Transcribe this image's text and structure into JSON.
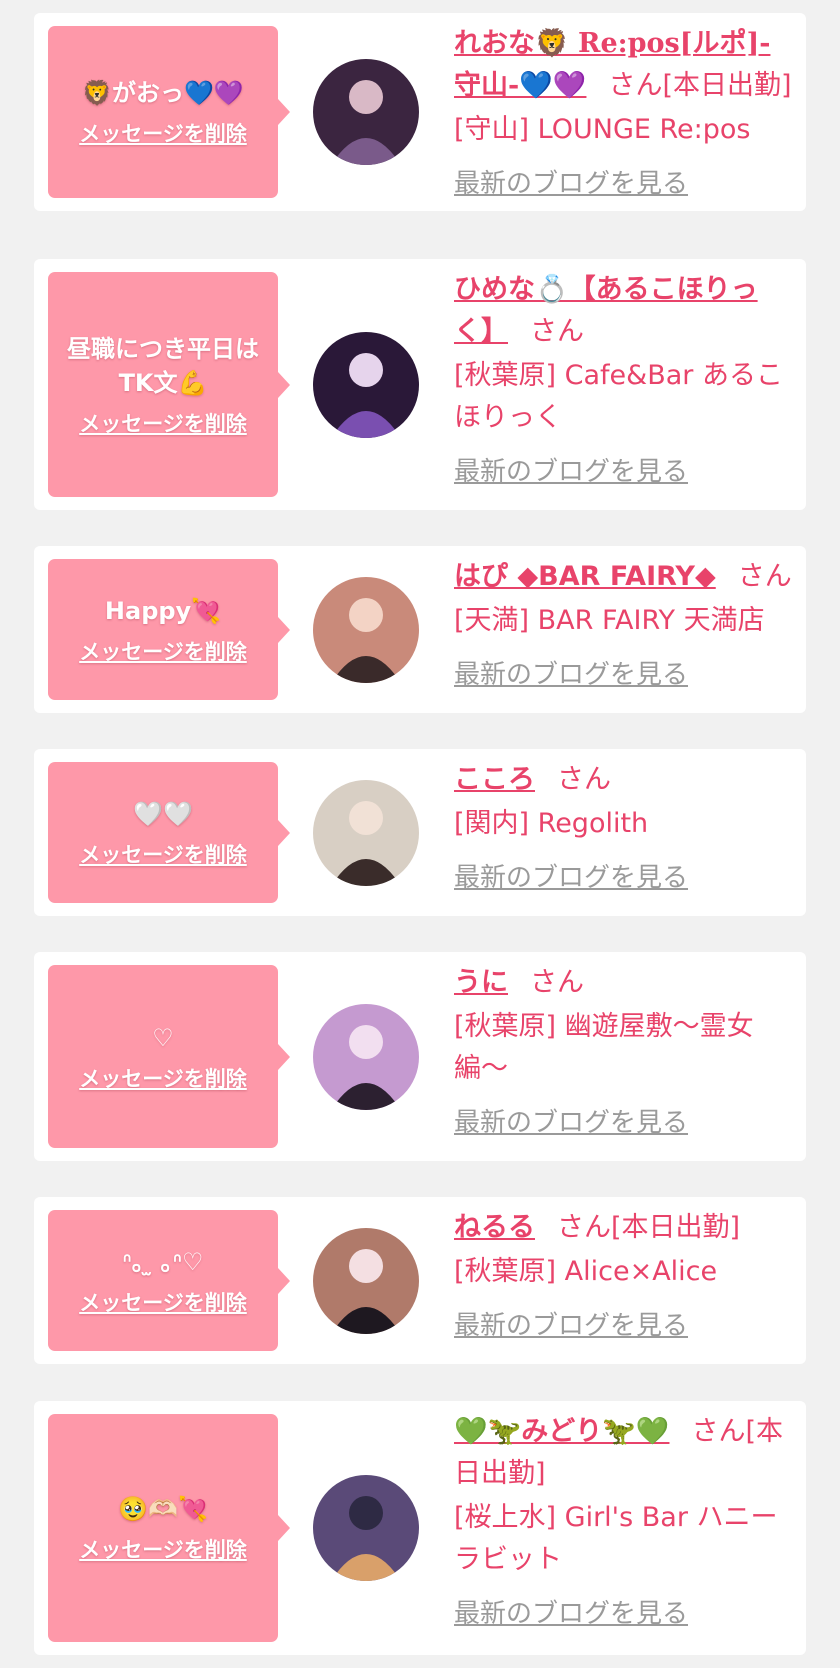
{
  "delete_label": "メッセージを削除",
  "blog_label": "最新のブログを見る",
  "colors": {
    "bubble": "#fe98a9",
    "accent": "#e8436a",
    "link_gray": "#9a9a9a",
    "background": "#f1f1f1"
  },
  "entries": [
    {
      "message": "🦁がおっ💙💜",
      "name": "れおな🦁 Re:pos[ルポ]-守山-💙💜",
      "suffix": "さん[本日出勤]",
      "shop": "[守山] LOUNGE Re:pos",
      "avatar_colors": [
        "#3b2540",
        "#7a5a8a",
        "#d9b9c6"
      ]
    },
    {
      "message": "昼職につき平日は\nTK文💪",
      "name": "ひめな💍【あるこほりっく】",
      "suffix": "さん",
      "shop": "[秋葉原] Cafe&Bar あるこほりっく",
      "avatar_colors": [
        "#2a1838",
        "#7a4fb0",
        "#e6d4ec"
      ]
    },
    {
      "message": "Happy💘",
      "name": "はぴ ◆BAR FAIRY◆",
      "suffix": "さん",
      "shop": "[天満] BAR FAIRY 天満店",
      "avatar_colors": [
        "#c98a7a",
        "#3a2a2a",
        "#f3d3c5"
      ]
    },
    {
      "message": "🤍🤍",
      "name": "こころ",
      "suffix": "さん",
      "shop": "[関内] Regolith",
      "avatar_colors": [
        "#d8cfc4",
        "#3a2c2a",
        "#f1e1d6"
      ]
    },
    {
      "message": "♡",
      "name": "うに",
      "suffix": "さん",
      "shop": "[秋葉原] 幽遊屋敷〜霊女編〜",
      "avatar_colors": [
        "#c59ad0",
        "#2c2030",
        "#f2dff0"
      ]
    },
    {
      "message": "ᐢ｡ ̫ ｡ᐢ♡",
      "name": "ねるる",
      "suffix": "さん[本日出勤]",
      "shop": "[秋葉原] Alice×Alice",
      "avatar_colors": [
        "#b07a6a",
        "#1e1820",
        "#f4dfe2"
      ]
    },
    {
      "message": "🥹🫶🏻💘",
      "name": "💚🦖みどり🦖💚",
      "suffix": "さん[本日出勤]",
      "shop": "[桜上水] Girl's Bar ハニーラビット",
      "avatar_colors": [
        "#5a4a78",
        "#d9a06a",
        "#2e2a44"
      ]
    }
  ]
}
